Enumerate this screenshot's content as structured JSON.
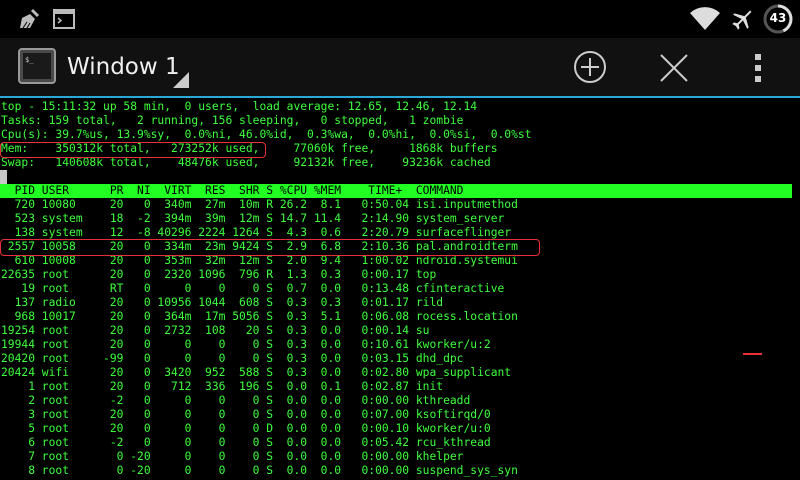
{
  "status_bar": {
    "notification_icons": [
      "broom-icon",
      "terminal-icon"
    ],
    "system_icons": [
      "wifi-icon",
      "airplane-icon"
    ],
    "battery_level": "43"
  },
  "action_bar": {
    "title": "Window 1",
    "buttons": [
      "add-window-icon",
      "close-window-icon",
      "overflow-menu-icon"
    ]
  },
  "terminal": {
    "summary_lines": [
      "top - 15:11:32 up 58 min,  0 users,  load average: 12.65, 12.46, 12.14",
      "Tasks: 159 total,   2 running, 156 sleeping,   0 stopped,   1 zombie",
      "Cpu(s): 39.7%us, 13.9%sy,  0.0%ni, 46.0%id,  0.3%wa,  0.0%hi,  0.0%si,  0.0%st",
      "Mem:    350312k total,   273252k used,     77060k free,     1868k buffers",
      "Swap:   140608k total,    48476k used,     92132k free,    93236k cached"
    ],
    "header": "  PID USER      PR  NI  VIRT  RES  SHR S %CPU %MEM    TIME+  COMMAND",
    "rows": [
      "  720 10080     20   0  340m  27m  10m R 26.2  8.1   0:50.04 isi.inputmethod",
      "  523 system    18  -2  394m  39m  12m S 14.7 11.4   2:14.90 system_server",
      "  138 system    12  -8 40296 2224 1264 S  4.3  0.6   2:20.79 surfaceflinger",
      " 2557 10058     20   0  334m  23m 9424 S  2.9  6.8   2:10.36 pal.androidterm",
      "  610 10008     20   0  353m  32m  12m S  2.0  9.4   1:00.02 ndroid.systemui",
      "22635 root      20   0  2320 1096  796 R  1.3  0.3   0:00.17 top",
      "   19 root      RT   0     0    0    0 S  0.7  0.0   0:13.48 cfinteractive",
      "  137 radio     20   0 10956 1044  608 S  0.3  0.3   0:01.17 rild",
      "  968 10017     20   0  364m  17m 5056 S  0.3  5.1   0:06.08 rocess.location",
      "19254 root      20   0  2732  108   20 S  0.3  0.0   0:00.14 su",
      "19944 root      20   0     0    0    0 S  0.3  0.0   0:10.61 kworker/u:2",
      "20420 root     -99   0     0    0    0 S  0.3  0.0   0:03.15 dhd_dpc",
      "20424 wifi      20   0  3420  952  588 S  0.3  0.0   0:02.80 wpa_supplicant",
      "    1 root      20   0   712  336  196 S  0.0  0.1   0:02.87 init",
      "    2 root      -2   0     0    0    0 S  0.0  0.0   0:00.00 kthreadd",
      "    3 root      20   0     0    0    0 S  0.0  0.0   0:07.00 ksoftirqd/0",
      "    5 root      20   0     0    0    0 D  0.0  0.0   0:00.10 kworker/u:0",
      "    6 root      -2   0     0    0    0 S  0.0  0.0   0:05.42 rcu_kthread",
      "    7 root       0 -20     0    0    0 S  0.0  0.0   0:00.00 khelper",
      "    8 root       0 -20     0    0    0 S  0.0  0.0   0:00.00 suspend_sys_syn"
    ]
  },
  "colors": {
    "terminal_text": "#3dff3d",
    "header_bar": "#22ff22",
    "highlight_annotation": "#e8303a",
    "action_bar_divider": "#2aa8d8"
  }
}
